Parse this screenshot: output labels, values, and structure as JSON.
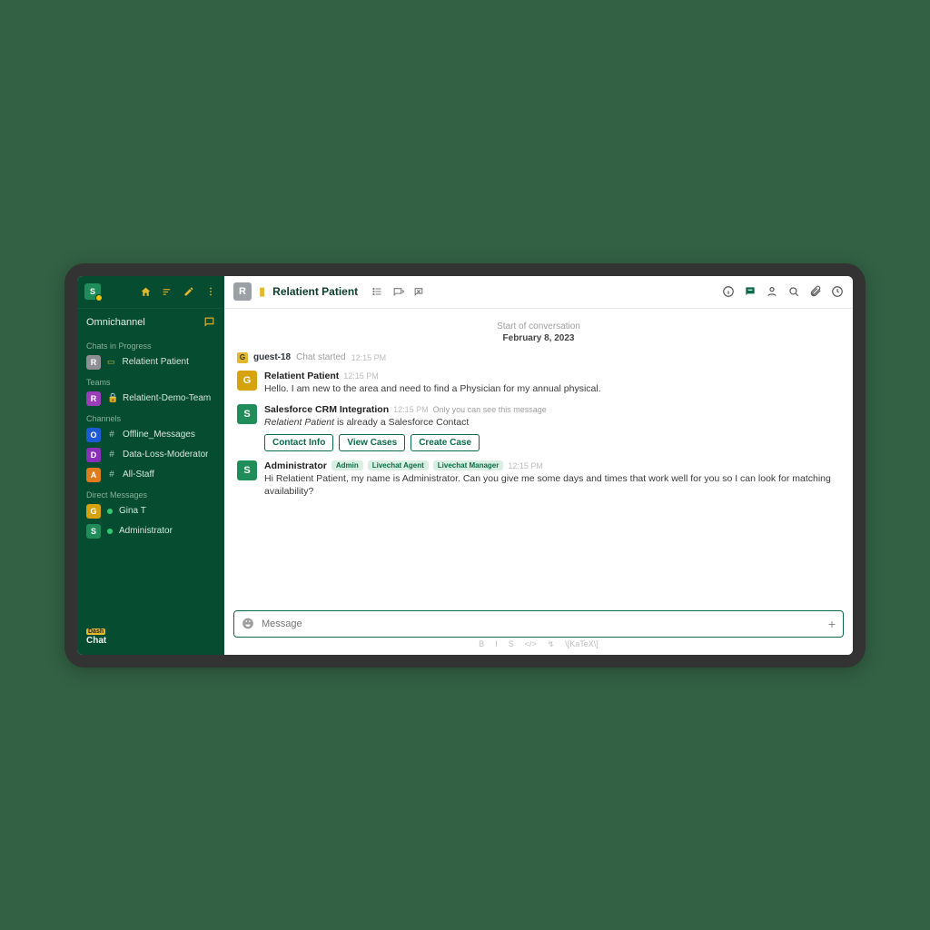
{
  "workspace_letter": "S",
  "omnichannel_label": "Omnichannel",
  "sidebar": {
    "sections": {
      "chats_title": "Chats in Progress",
      "teams_title": "Teams",
      "channels_title": "Channels",
      "dms_title": "Direct Messages"
    },
    "chat0": {
      "letter": "R",
      "color": "#8d8f93",
      "label": "Relatient Patient"
    },
    "team0": {
      "letter": "R",
      "color": "#9b3db8",
      "label": "Relatient-Demo-Team"
    },
    "ch0": {
      "letter": "O",
      "color": "#1d5ad6",
      "label": "Offline_Messages"
    },
    "ch1": {
      "letter": "D",
      "color": "#8a2fbb",
      "label": "Data-Loss-Moderator"
    },
    "ch2": {
      "letter": "A",
      "color": "#e07c1b",
      "label": "All-Staff"
    },
    "dm0": {
      "letter": "G",
      "color": "#d6a20d",
      "label": "Gina T"
    },
    "dm1": {
      "letter": "S",
      "color": "#1f8c5a",
      "label": "Administrator"
    }
  },
  "footer": {
    "brand": "Chat",
    "tag": "Dash"
  },
  "header": {
    "room_letter": "R",
    "room_title": "Relatient Patient"
  },
  "conversation": {
    "start_label": "Start of conversation",
    "date_label": "February 8, 2023",
    "sys": {
      "badge": "G",
      "user": "guest-18",
      "event": "Chat started",
      "time": "12:15 PM"
    },
    "m1": {
      "letter": "G",
      "color": "#d6a20d",
      "name": "Relatient Patient",
      "time": "12:15 PM",
      "text": "Hello.  I am new to the area and need to find a Physician for my annual physical."
    },
    "m2": {
      "letter": "S",
      "color": "#1f8c5a",
      "name": "Salesforce CRM Integration",
      "time": "12:15 PM",
      "note": "Only you can see this message",
      "text_prefix_italic": "Relatient Patient",
      "text_rest": " is already a Salesforce Contact",
      "buttons": {
        "b1": "Contact Info",
        "b2": "View Cases",
        "b3": "Create Case"
      }
    },
    "m3": {
      "letter": "S",
      "color": "#1f8c5a",
      "name": "Administrator",
      "time": "12:15 PM",
      "roles": {
        "r1": "Admin",
        "r2": "Livechat Agent",
        "r3": "Livechat Manager"
      },
      "text": "Hi Relatient Patient, my name is Administrator. Can you give me some days and times that work well for you so I can look for matching availability?"
    }
  },
  "composer": {
    "placeholder": "Message"
  },
  "toolbar": {
    "t1": "B",
    "t2": "I",
    "t3": "S",
    "t4": "</>",
    "t5": "↯",
    "t6": "\\[KaTeX\\]"
  }
}
